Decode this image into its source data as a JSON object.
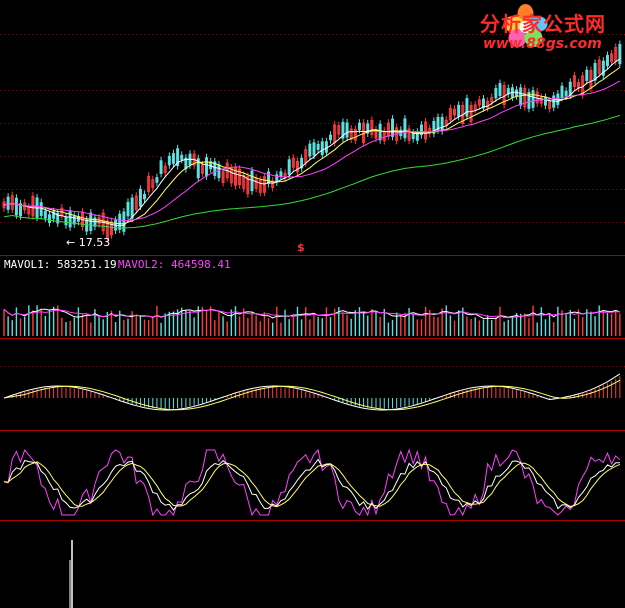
{
  "logo": {
    "name": "分析家公式网",
    "url": "www.88gs.com"
  },
  "panel_labels": {
    "mavol1": "MAVOL1: 583251.19",
    "mavol2": "MAVOL2: 464598.41"
  },
  "markers": {
    "low_price": "17.53",
    "signal": "$"
  },
  "colors": {
    "up": "#ff3c3c",
    "down": "#5ce0e0",
    "white": "#ffffff",
    "yellow": "#ffff66",
    "magenta": "#ff40ff",
    "green": "#33dd33",
    "panel_line": "#aa0000"
  },
  "chart_data": [
    {
      "type": "candlestick",
      "title": "",
      "price_low_marker": 17.53,
      "series": [
        {
          "name": "",
          "values": []
        }
      ]
    },
    {
      "type": "bar",
      "title": "",
      "series": [
        {
          "name": "MAVOL1",
          "values": [
            583251.19
          ]
        },
        {
          "name": "MAVOL2",
          "values": [
            464598.41
          ]
        }
      ]
    },
    {
      "type": "bar",
      "title": "",
      "series": []
    },
    {
      "type": "line",
      "title": "",
      "series": []
    },
    {
      "type": "bar",
      "title": "",
      "series": []
    }
  ]
}
